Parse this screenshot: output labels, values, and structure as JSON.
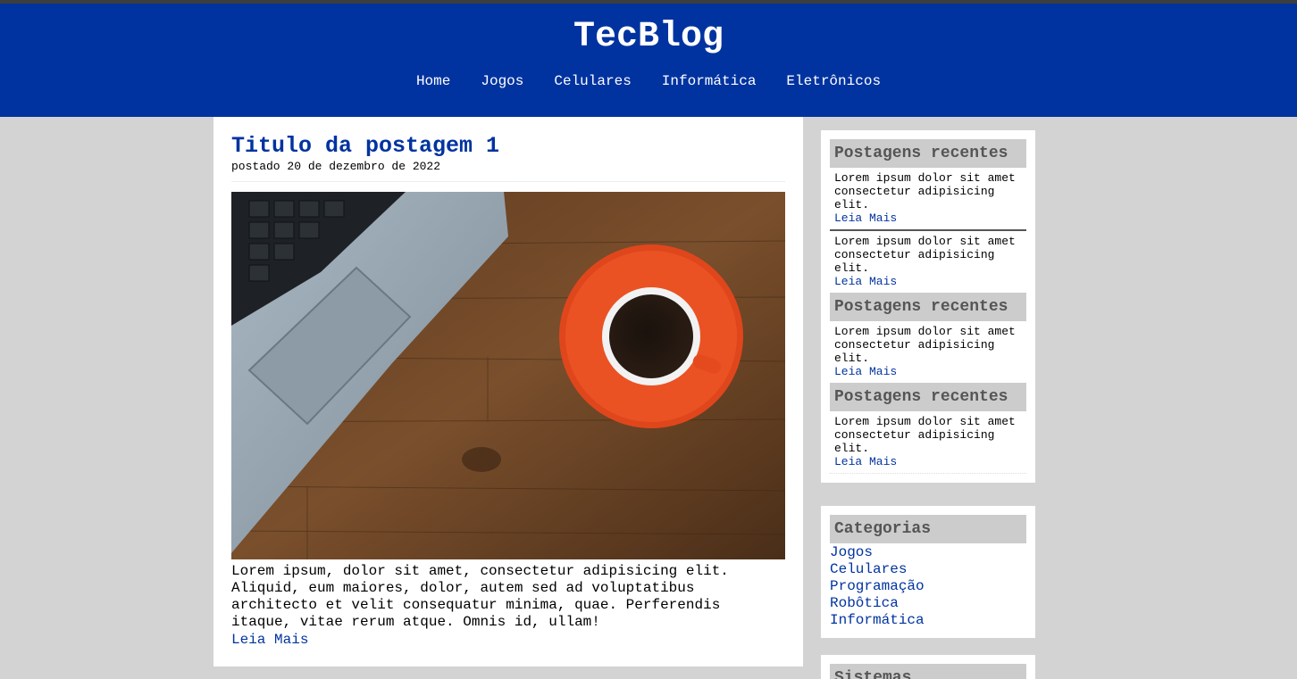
{
  "site": {
    "title": "TecBlog"
  },
  "nav": [
    "Home",
    "Jogos",
    "Celulares",
    "Informática",
    "Eletrônicos"
  ],
  "post": {
    "title": "Titulo da postagem 1",
    "date": "postado 20 de dezembro de 2022",
    "text": "Lorem ipsum, dolor sit amet, consectetur adipisicing elit. Aliquid, eum maiores, dolor, autem sed ad voluptatibus architecto et velit consequatur minima, quae. Perferendis itaque, vitae rerum atque. Omnis id, ullam!",
    "more": "Leia Mais"
  },
  "recent": {
    "heading": "Postagens recentes",
    "item_text": "Lorem ipsum dolor sit amet consectetur adipisicing elit.",
    "more": "Leia Mais"
  },
  "categories": {
    "heading": "Categorias",
    "items": [
      "Jogos",
      "Celulares",
      "Programação",
      "Robôtica",
      "Informática"
    ]
  },
  "systems": {
    "heading": "Sistemas"
  },
  "colors": {
    "header": "#0033a0",
    "background": "#d3d3d3",
    "accent_link": "#0033a0",
    "widget_heading": "#cccccc"
  }
}
